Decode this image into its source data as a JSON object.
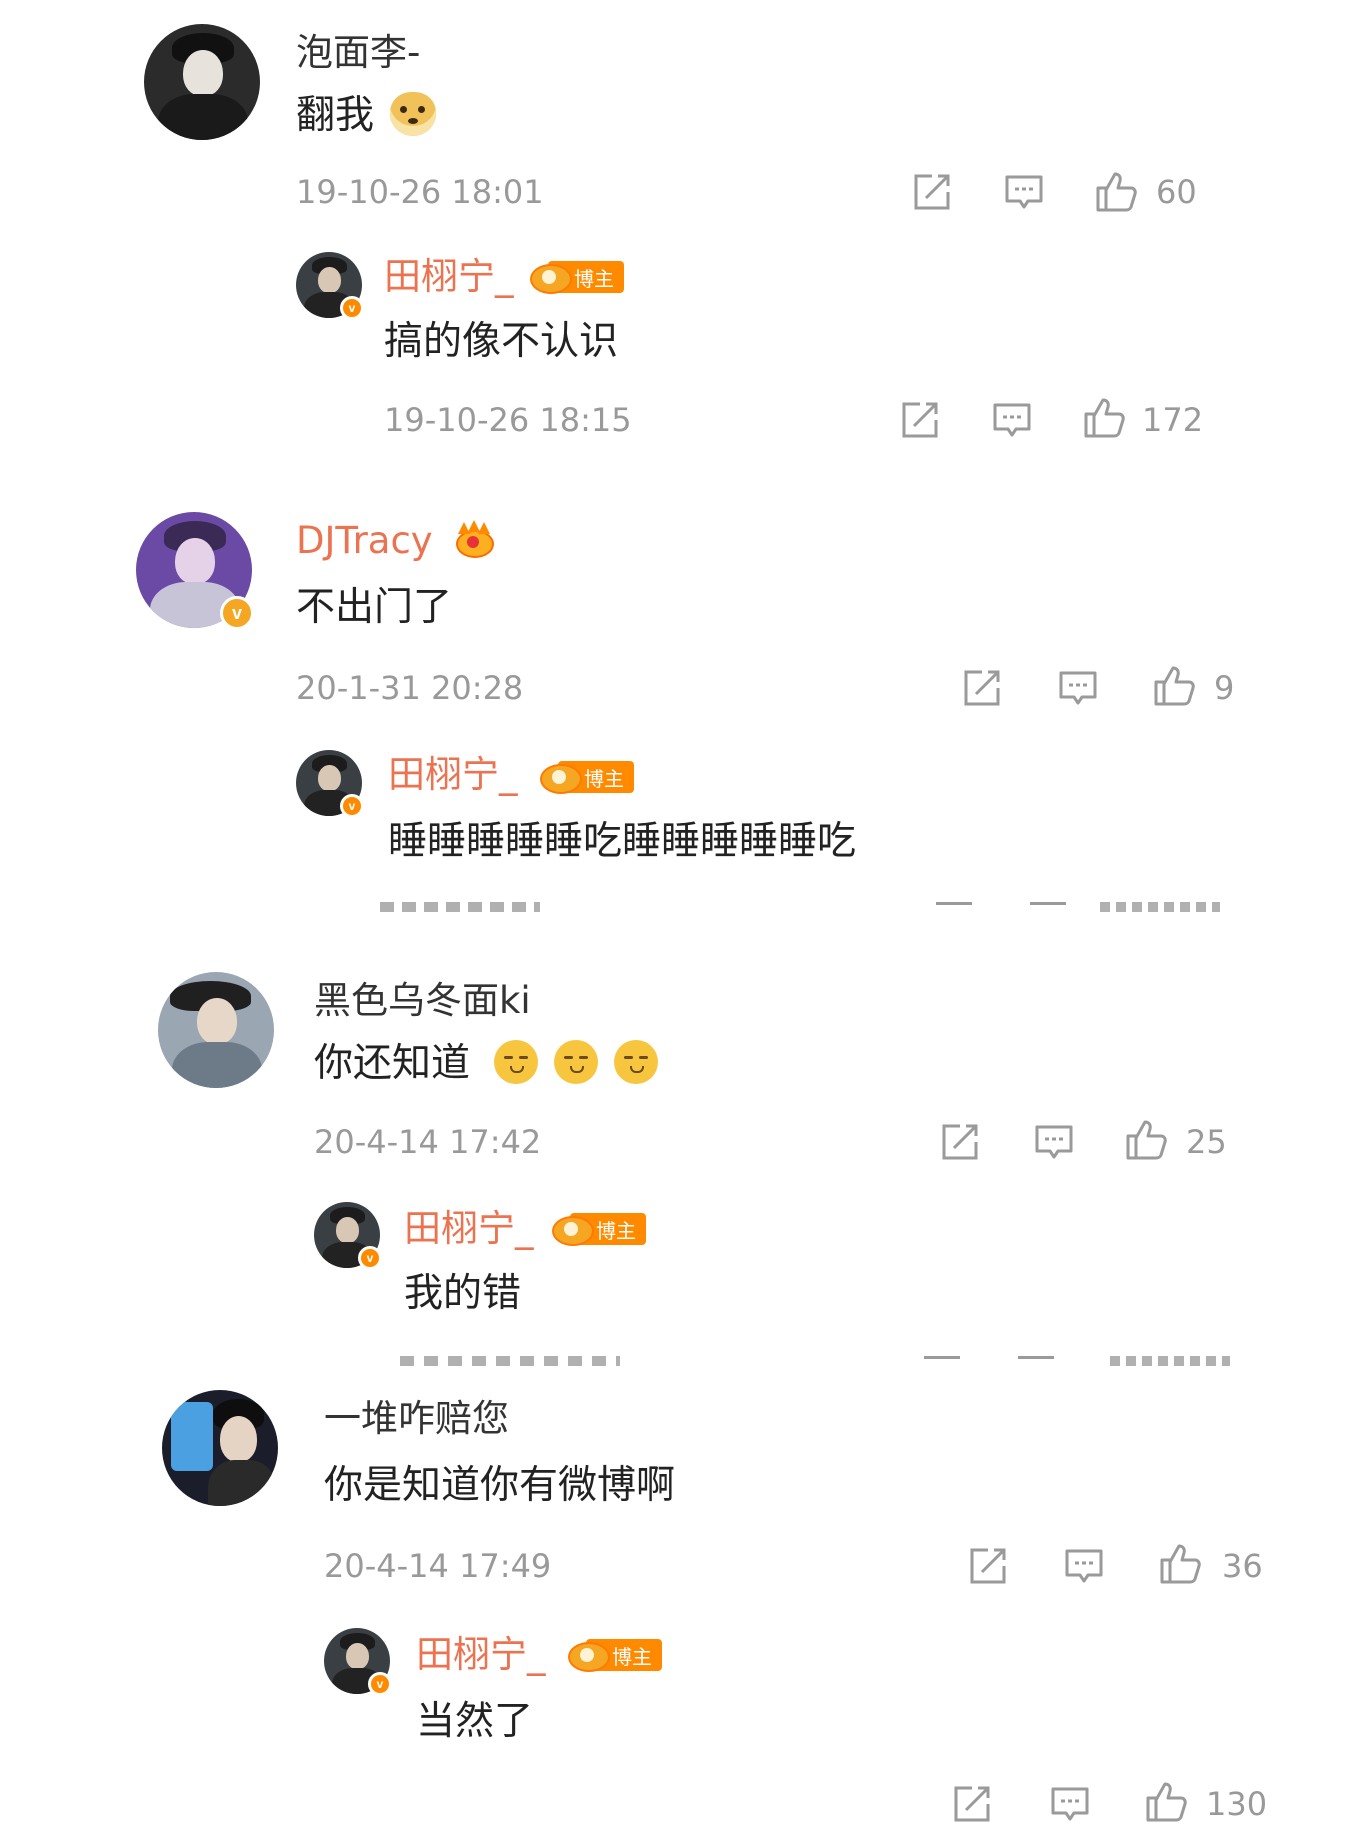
{
  "colors": {
    "orange_name": "#eb7350",
    "gray_name": "#333333",
    "meta": "#999999",
    "icon": "#9a9a9a",
    "vip_badge": "#ff9900",
    "blogger_tag": "#ff8a00",
    "verify_badge": "#f5a623"
  },
  "comments": [
    {
      "author": "泡面李-",
      "text": "翻我",
      "emoji": "doge",
      "time": "19-10-26 18:01",
      "likes": "60",
      "reply": {
        "author": "田栩宁_",
        "badge_label": "博主",
        "text": "搞的像不认识",
        "time": "19-10-26 18:15",
        "likes": "172"
      }
    },
    {
      "author": "DJTracy",
      "badge": "crown",
      "text": "不出门了",
      "time": "20-1-31 20:28",
      "likes": "9",
      "reply": {
        "author": "田栩宁_",
        "badge_label": "博主",
        "text": "睡睡睡睡睡吃睡睡睡睡睡吃"
      }
    },
    {
      "author": "黑色乌冬面ki",
      "text": "你还知道",
      "emoji": "shush-emoji-x3",
      "time": "20-4-14 17:42",
      "likes": "25",
      "reply": {
        "author": "田栩宁_",
        "badge_label": "博主",
        "text": "我的错"
      }
    },
    {
      "author": "一堆咋赔您",
      "text": "你是知道你有微博啊",
      "time": "20-4-14 17:49",
      "likes": "36",
      "reply": {
        "author": "田栩宁_",
        "badge_label": "博主",
        "text": "当然了",
        "likes": "130"
      }
    }
  ],
  "icons": [
    "share-icon",
    "comment-icon",
    "like-icon"
  ]
}
